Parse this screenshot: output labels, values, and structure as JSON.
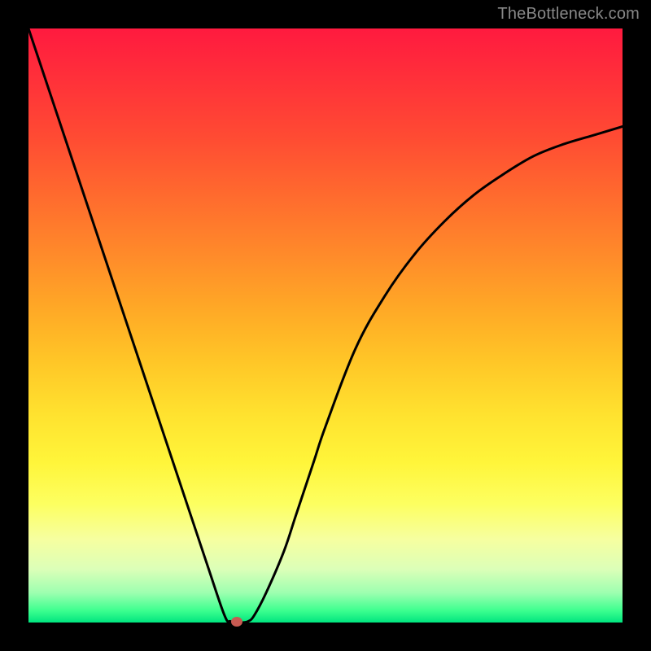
{
  "watermark": "TheBottleneck.com",
  "colors": {
    "page_bg": "#000000",
    "curve": "#000000",
    "dot": "#c75a52",
    "gradient_top": "#ff1a3f",
    "gradient_bottom": "#00e57f"
  },
  "chart_data": {
    "type": "line",
    "title": "",
    "xlabel": "",
    "ylabel": "",
    "xlim": [
      0,
      100
    ],
    "ylim": [
      0,
      100
    ],
    "grid": false,
    "series": [
      {
        "name": "bottleneck-v-curve",
        "x": [
          0,
          5,
          10,
          15,
          20,
          25,
          30,
          33,
          34,
          35,
          36,
          37,
          38,
          40,
          43,
          45,
          48,
          50,
          55,
          60,
          65,
          70,
          75,
          80,
          85,
          90,
          95,
          100
        ],
        "values": [
          100,
          85,
          70,
          55,
          40,
          25,
          10,
          1.2,
          0.2,
          0,
          0,
          0.2,
          1.2,
          5.0,
          12,
          18,
          27,
          33,
          46,
          55,
          62,
          67.5,
          72,
          75.5,
          78.5,
          80.5,
          82,
          83.5
        ]
      }
    ],
    "annotations": [
      {
        "name": "min-dot",
        "x": 35,
        "y": 0.2
      }
    ]
  }
}
